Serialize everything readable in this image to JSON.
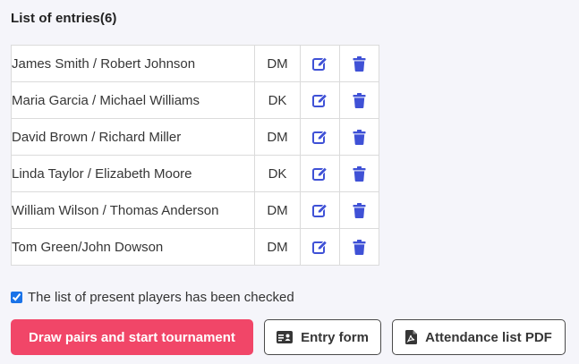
{
  "header": {
    "title": "List of entries(6)"
  },
  "entries": [
    {
      "names": "James Smith / Robert Johnson",
      "category": "DM"
    },
    {
      "names": "Maria Garcia / Michael Williams",
      "category": "DK"
    },
    {
      "names": "David Brown / Richard Miller",
      "category": "DM"
    },
    {
      "names": "Linda Taylor / Elizabeth Moore",
      "category": "DK"
    },
    {
      "names": "William Wilson / Thomas Anderson",
      "category": "DM"
    },
    {
      "names": "Tom Green/John Dowson",
      "category": "DM"
    }
  ],
  "checkbox": {
    "label": "The list of present players has been checked",
    "checked": true
  },
  "buttons": {
    "draw": "Draw pairs and start tournament",
    "entry_form": "Entry form",
    "attendance_pdf": "Attendance list PDF"
  },
  "icons": {
    "edit": "edit-icon",
    "delete": "trash-icon",
    "entry_form": "id-card-icon",
    "pdf": "file-pdf-icon"
  },
  "colors": {
    "action_icon": "#3f51d6",
    "primary_button": "#f14668"
  }
}
